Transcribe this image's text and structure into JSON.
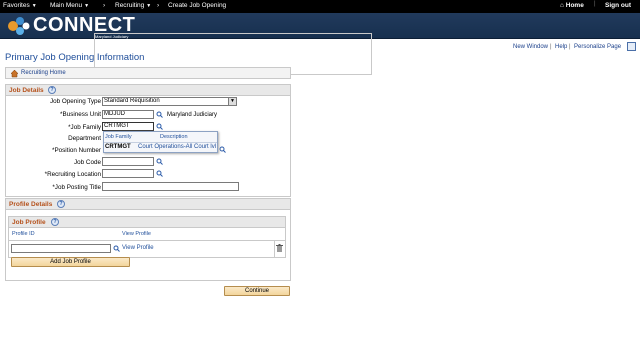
{
  "topnav": {
    "favorites": "Favorites",
    "main_menu": "Main Menu",
    "recruiting": "Recruiting",
    "create_job_opening": "Create Job Opening",
    "home": "Home",
    "signout": "Sign out"
  },
  "brand": {
    "name": "CONNECT",
    "subtitle": "Maryland Judiciary"
  },
  "util": {
    "new_window": "New Window",
    "help": "Help",
    "personalize": "Personalize Page"
  },
  "page_title": "Primary Job Opening Information",
  "recruiting_home": "Recruiting Home",
  "job_details": {
    "title": "Job Details",
    "job_opening_type_label": "Job Opening Type",
    "job_opening_type_value": "Standard Requisition",
    "business_unit_label": "*Business Unit",
    "business_unit_value": "MDJUD",
    "business_unit_desc": "Maryland Judiciary",
    "job_family_label": "*Job Family",
    "job_family_value": "CRTMGT",
    "department_label": "Department",
    "position_number_label": "*Position Number",
    "job_code_label": "Job Code",
    "recruiting_location_label": "*Recruiting Location",
    "job_posting_title_label": "*Job Posting Title"
  },
  "autocomplete": {
    "col1": "Job Family",
    "col2": "Description",
    "row_code": "CRTMGT",
    "row_desc": "Court Operations-All Court lvl"
  },
  "profile_details": {
    "title": "Profile Details",
    "job_profile_title": "Job Profile",
    "profile_id_header": "Profile ID",
    "view_profile_header": "View Profile",
    "view_profile_link": "View Profile",
    "add_button": "Add Job Profile"
  },
  "continue_button": "Continue"
}
